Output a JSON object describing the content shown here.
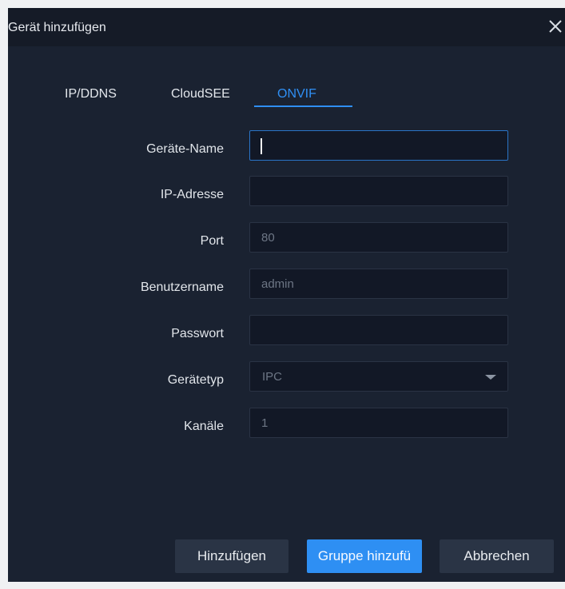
{
  "window": {
    "title": "Gerät hinzufügen",
    "close_icon": "close-icon"
  },
  "tabs": [
    {
      "label": "IP/DDNS",
      "active": false
    },
    {
      "label": "CloudSEE",
      "active": false
    },
    {
      "label": "ONVIF",
      "active": true
    }
  ],
  "form": {
    "device_name": {
      "label": "Geräte-Name",
      "value": ""
    },
    "ip_address": {
      "label": "IP-Adresse",
      "value": ""
    },
    "port": {
      "label": "Port",
      "value": "80"
    },
    "username": {
      "label": "Benutzername",
      "value": "admin"
    },
    "password": {
      "label": "Passwort",
      "value": ""
    },
    "device_type": {
      "label": "Gerätetyp",
      "value": "IPC"
    },
    "channels": {
      "label": "Kanäle",
      "value": "1"
    }
  },
  "buttons": {
    "add": "Hinzufügen",
    "add_group": "Gruppe hinzufü",
    "cancel": "Abbrechen"
  },
  "colors": {
    "accent": "#2f8ff4",
    "background": "#1a2231",
    "titlebar": "#151b27",
    "button": "#2a3445"
  }
}
